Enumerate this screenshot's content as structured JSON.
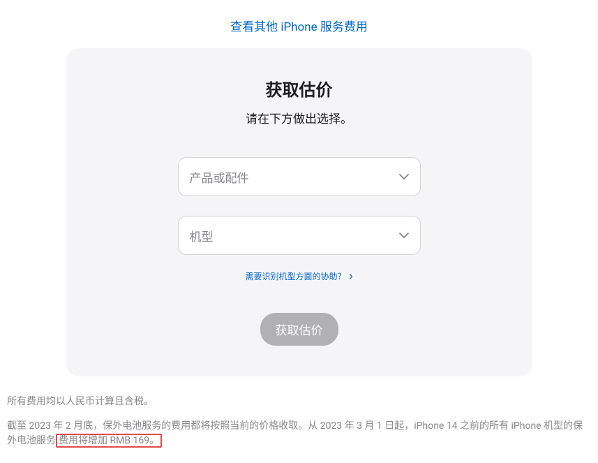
{
  "topLink": {
    "label": "查看其他 iPhone 服务费用"
  },
  "card": {
    "title": "获取估价",
    "subtitle": "请在下方做出选择。",
    "select1": {
      "placeholder": "产品或配件"
    },
    "select2": {
      "placeholder": "机型"
    },
    "helpLink": {
      "label": "需要识别机型方面的协助？"
    },
    "submit": {
      "label": "获取估价"
    }
  },
  "footer": {
    "note1": "所有费用均以人民币计算且含税。",
    "note2_part1": "截至 2023 年 2 月底，保外电池服务的费用都将按照当前的价格收取。从 2023 年 3 月 1 日起，iPhone 14 之前的所有 iPhone 机型的保外电池服务",
    "note2_highlight": "费用将增加 RMB 169。"
  }
}
